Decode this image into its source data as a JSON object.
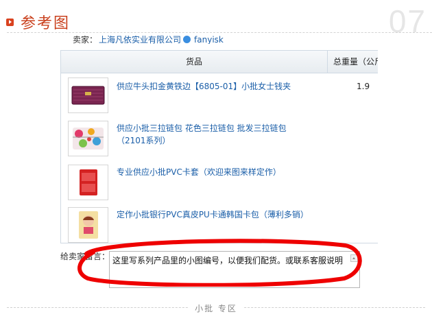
{
  "header": {
    "title": "参考图",
    "number": "07"
  },
  "seller": {
    "label": "卖家：",
    "company": "上海凡依实业有限公司",
    "account": "fanyisk"
  },
  "table": {
    "col_goods": "货品",
    "col_weight": "总重量（公斤）",
    "rows": [
      {
        "name": "供应牛头扣金黄铁边【6805-01】小批女士钱夹",
        "weight": "1.9",
        "thumb": "purple-wallet-icon"
      },
      {
        "name": "供应小批三拉链包 花色三拉链包 批发三拉链包（2101系列）",
        "weight": "",
        "thumb": "floral-zipper-bag-icon"
      },
      {
        "name": "专业供应小批PVC卡套（欢迎来图来样定作）",
        "weight": "",
        "thumb": "red-card-holder-icon"
      },
      {
        "name": "定作小批银行PVC真皮PU卡通韩国卡包（薄利多销）",
        "weight": "",
        "thumb": "cartoon-card-wallet-icon"
      }
    ]
  },
  "message": {
    "label": "给卖家留言：",
    "value": "这里写系列产品里的小图编号，以便我们配货。或联系客服说明"
  },
  "footer": {
    "text": "小批 专区"
  },
  "colors": {
    "title_red": "#c9401d",
    "link_blue": "#1a5ea8",
    "annotation_red": "#ee0000"
  }
}
